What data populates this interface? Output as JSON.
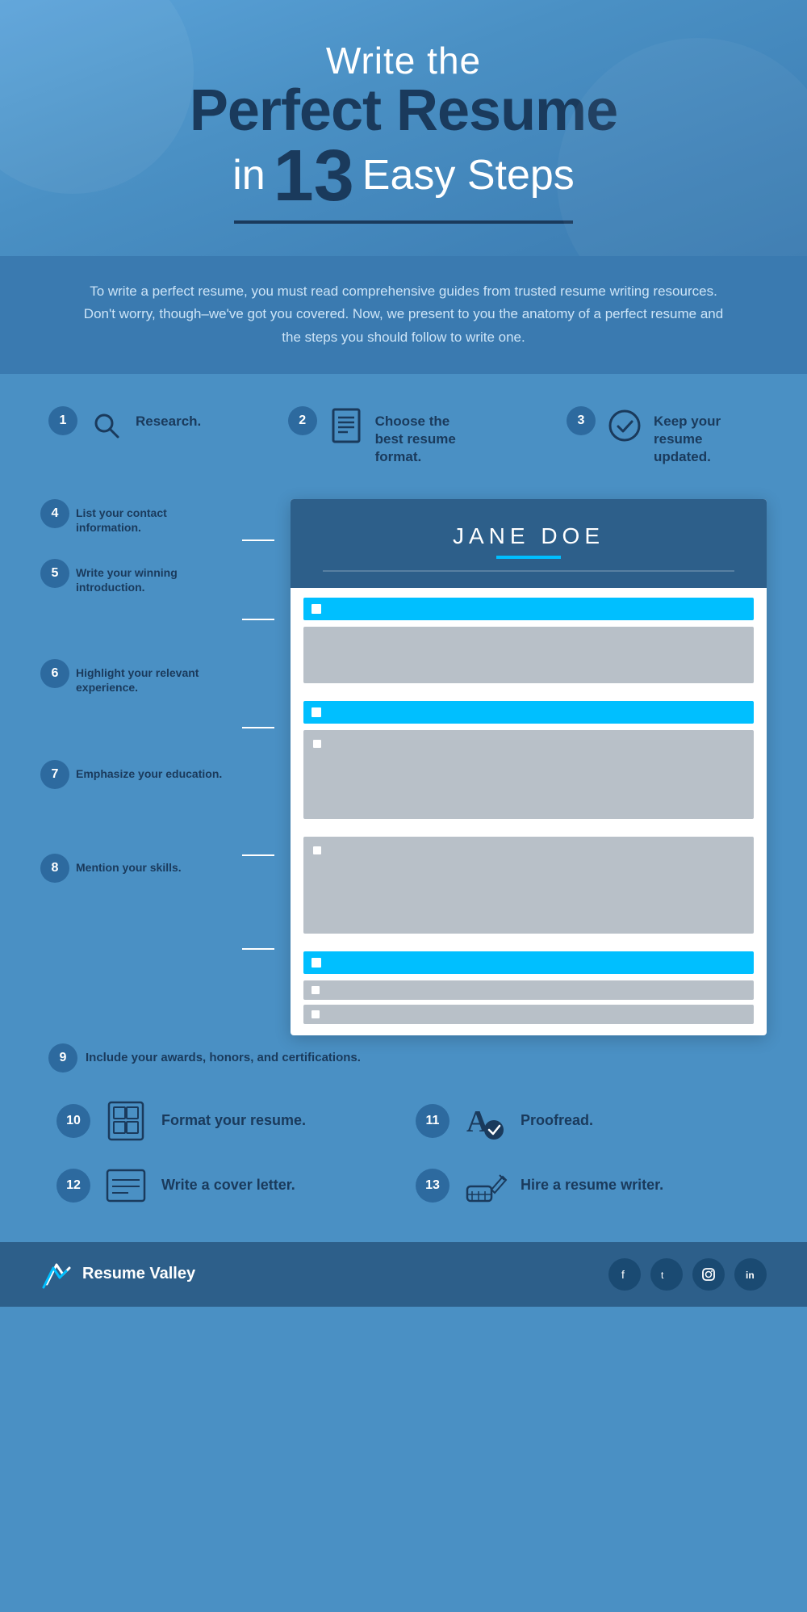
{
  "header": {
    "line1": "Write the",
    "line2": "Perfect Resume",
    "line3_prefix": "in",
    "line3_num": "13",
    "line3_suffix": "Easy Steps"
  },
  "intro": {
    "text": "To write a perfect resume, you must read comprehensive guides from trusted resume writing resources. Don't worry, though–we've got you covered. Now, we present to you the anatomy of a perfect resume and the steps you should follow to write one."
  },
  "steps": {
    "step1_num": "1",
    "step1_label": "Research.",
    "step2_num": "2",
    "step2_label": "Choose the best resume format.",
    "step3_num": "3",
    "step3_label": "Keep your resume updated.",
    "step4_num": "4",
    "step4_label": "List your contact information.",
    "step5_num": "5",
    "step5_label": "Write your winning introduction.",
    "step6_num": "6",
    "step6_label": "Highlight your relevant experience.",
    "step7_num": "7",
    "step7_label": "Emphasize your education.",
    "step8_num": "8",
    "step8_label": "Mention your skills.",
    "step9_num": "9",
    "step9_label": "Include your awards, honors, and certifications.",
    "step10_num": "10",
    "step10_label": "Format your resume.",
    "step11_num": "11",
    "step11_label": "Proofread.",
    "step12_num": "12",
    "step12_label": "Write a cover letter.",
    "step13_num": "13",
    "step13_label": "Hire a resume writer."
  },
  "resume_mockup": {
    "name": "JANE DOE"
  },
  "footer": {
    "brand": "Resume Valley",
    "socials": [
      "f",
      "t",
      "cam",
      "in"
    ]
  }
}
